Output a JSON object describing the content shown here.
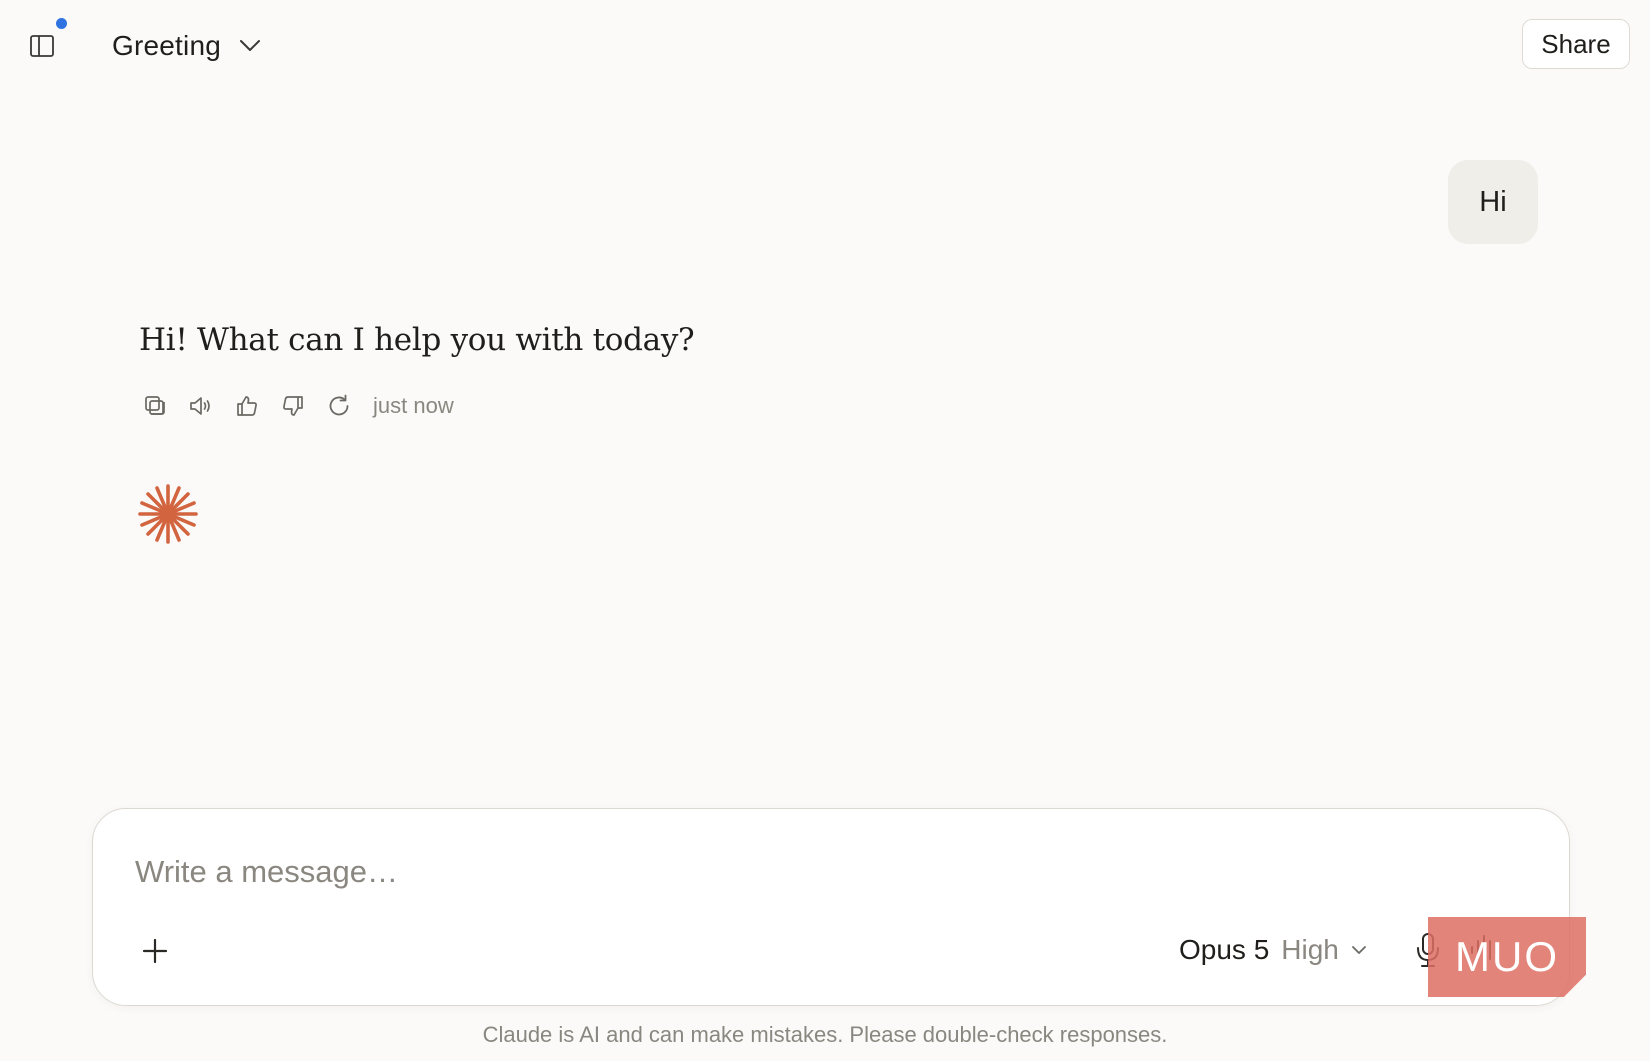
{
  "header": {
    "conversation_title": "Greeting",
    "share_label": "Share"
  },
  "conversation": {
    "user_message": "Hi",
    "assistant_message": "Hi! What can I help you with today?",
    "timestamp": "just now"
  },
  "composer": {
    "placeholder": "Write a message…",
    "model": "Opus 5",
    "effort": "High"
  },
  "footer": {
    "disclaimer": "Claude is AI and can make mistakes. Please double-check responses."
  },
  "watermark": {
    "text": "MUO"
  },
  "colors": {
    "background": "#FBFAF8",
    "accent_spark": "#D2643F",
    "notification_dot": "#2F73E0"
  }
}
